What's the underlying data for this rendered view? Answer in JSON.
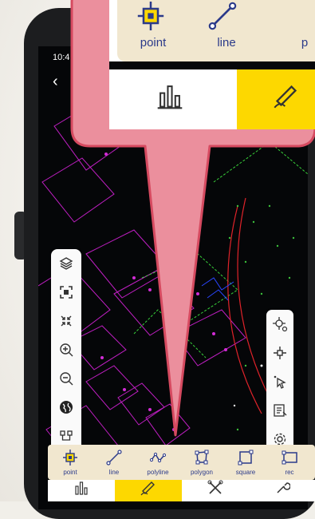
{
  "status": {
    "time": "10:4"
  },
  "navigation": {
    "back_icon": "back-arrow-icon"
  },
  "map_tools_left": [
    {
      "name": "layers-icon"
    },
    {
      "name": "fit-extent-icon"
    },
    {
      "name": "collapse-icon"
    },
    {
      "name": "zoom-in-icon"
    },
    {
      "name": "zoom-out-icon"
    },
    {
      "name": "globe-icon"
    },
    {
      "name": "node-icon"
    }
  ],
  "map_tools_right": [
    {
      "name": "snap-point-icon"
    },
    {
      "name": "crosshair-icon"
    },
    {
      "name": "select-cursor-icon"
    },
    {
      "name": "attribute-table-icon"
    },
    {
      "name": "settings-icon"
    }
  ],
  "draw_tools": [
    {
      "label": "point"
    },
    {
      "label": "line"
    },
    {
      "label": "polyline"
    },
    {
      "label": "polygon"
    },
    {
      "label": "square"
    },
    {
      "label": "rec"
    }
  ],
  "bottom_tabs": [
    {
      "name": "survey-tab",
      "active": false
    },
    {
      "name": "draw-tab",
      "active": true
    },
    {
      "name": "tools-tab",
      "active": false
    },
    {
      "name": "settings-tab",
      "active": false
    }
  ],
  "callout": {
    "tools": [
      {
        "label": "point"
      },
      {
        "label": "line"
      },
      {
        "label": "p"
      }
    ]
  },
  "colors": {
    "accent": "#fdd800",
    "toolbar_bg": "#f1e7cf",
    "icon": "#2b3a8a",
    "callout_fill": "#eb8f9d",
    "callout_border": "#d64a60"
  }
}
